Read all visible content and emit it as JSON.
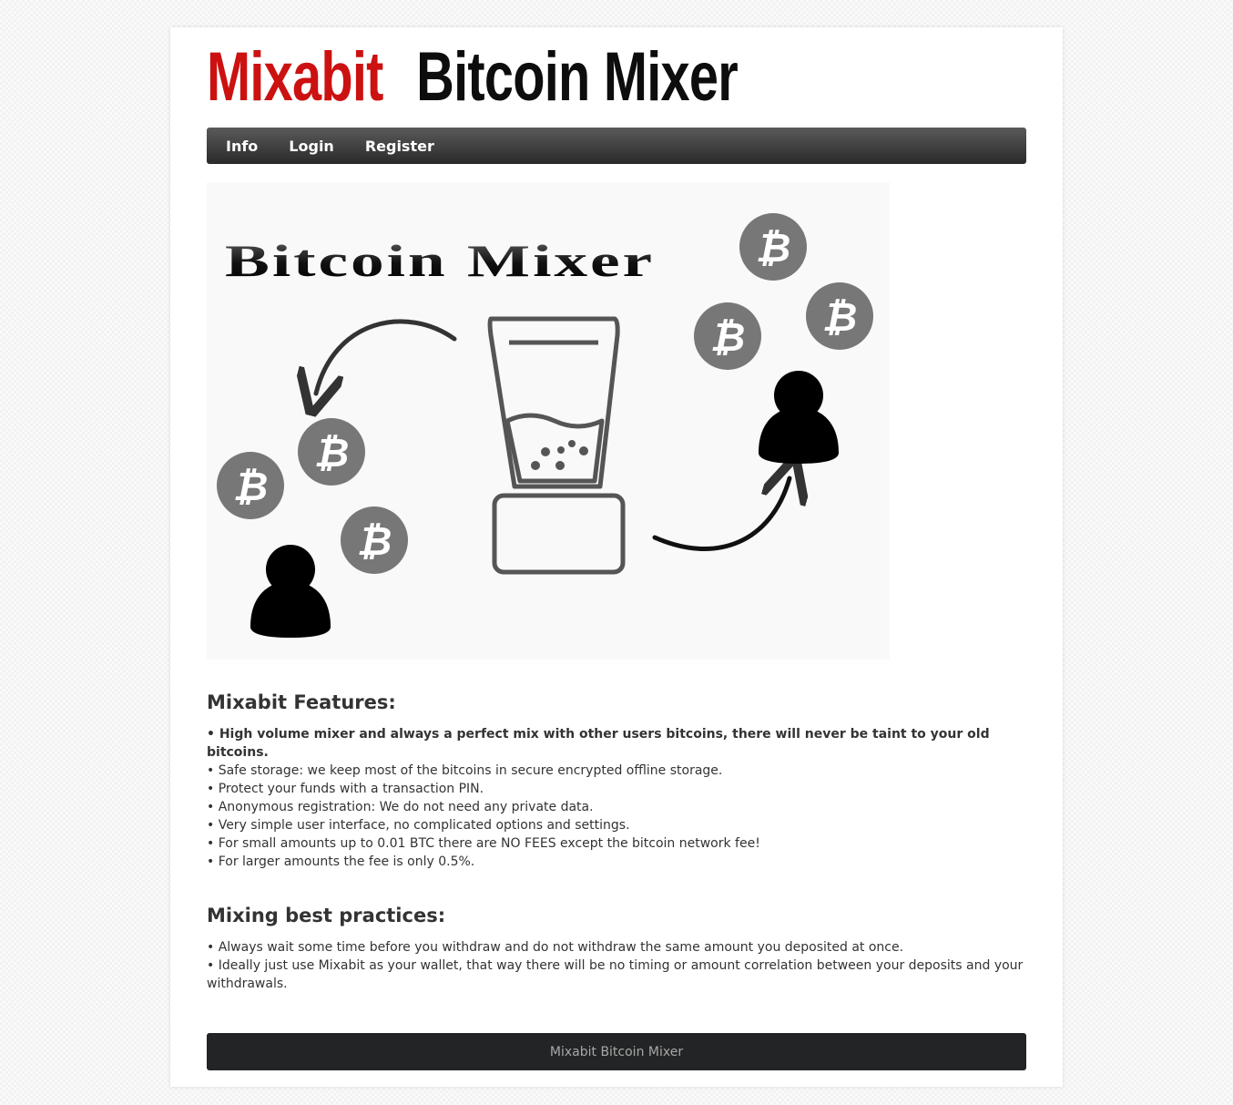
{
  "logo": {
    "brand": "Mixabit",
    "subtitle": "Bitcoin Mixer"
  },
  "nav": {
    "items": [
      {
        "label": "Info"
      },
      {
        "label": "Login"
      },
      {
        "label": "Register"
      }
    ]
  },
  "hero": {
    "title": "Bitcoin Mixer",
    "coin_symbol": "₿"
  },
  "features": {
    "heading": "Mixabit Features:",
    "items": [
      "• High volume mixer and always a perfect mix with other users bitcoins, there will never be taint to your old bitcoins.",
      "• Safe storage: we keep most of the bitcoins in secure encrypted offline storage.",
      "• Protect your funds with a transaction PIN.",
      "• Anonymous registration: We do not need any private data.",
      "• Very simple user interface, no complicated options and settings.",
      "• For small amounts up to 0.01 BTC there are NO FEES except the bitcoin network fee!",
      "• For larger amounts the fee is only 0.5%."
    ]
  },
  "practices": {
    "heading": "Mixing best practices:",
    "items": [
      "• Always wait some time before you withdraw and do not withdraw the same amount you deposited at once.",
      "• Ideally just use Mixabit as your wallet, that way there will be no timing or amount correlation between your deposits and your withdrawals."
    ]
  },
  "footer": {
    "text": "Mixabit Bitcoin Mixer"
  },
  "colors": {
    "brand_red": "#cc1111",
    "nav_dark": "#2a2a2a",
    "footer_bg": "#232425",
    "coin_gray": "#777777"
  }
}
